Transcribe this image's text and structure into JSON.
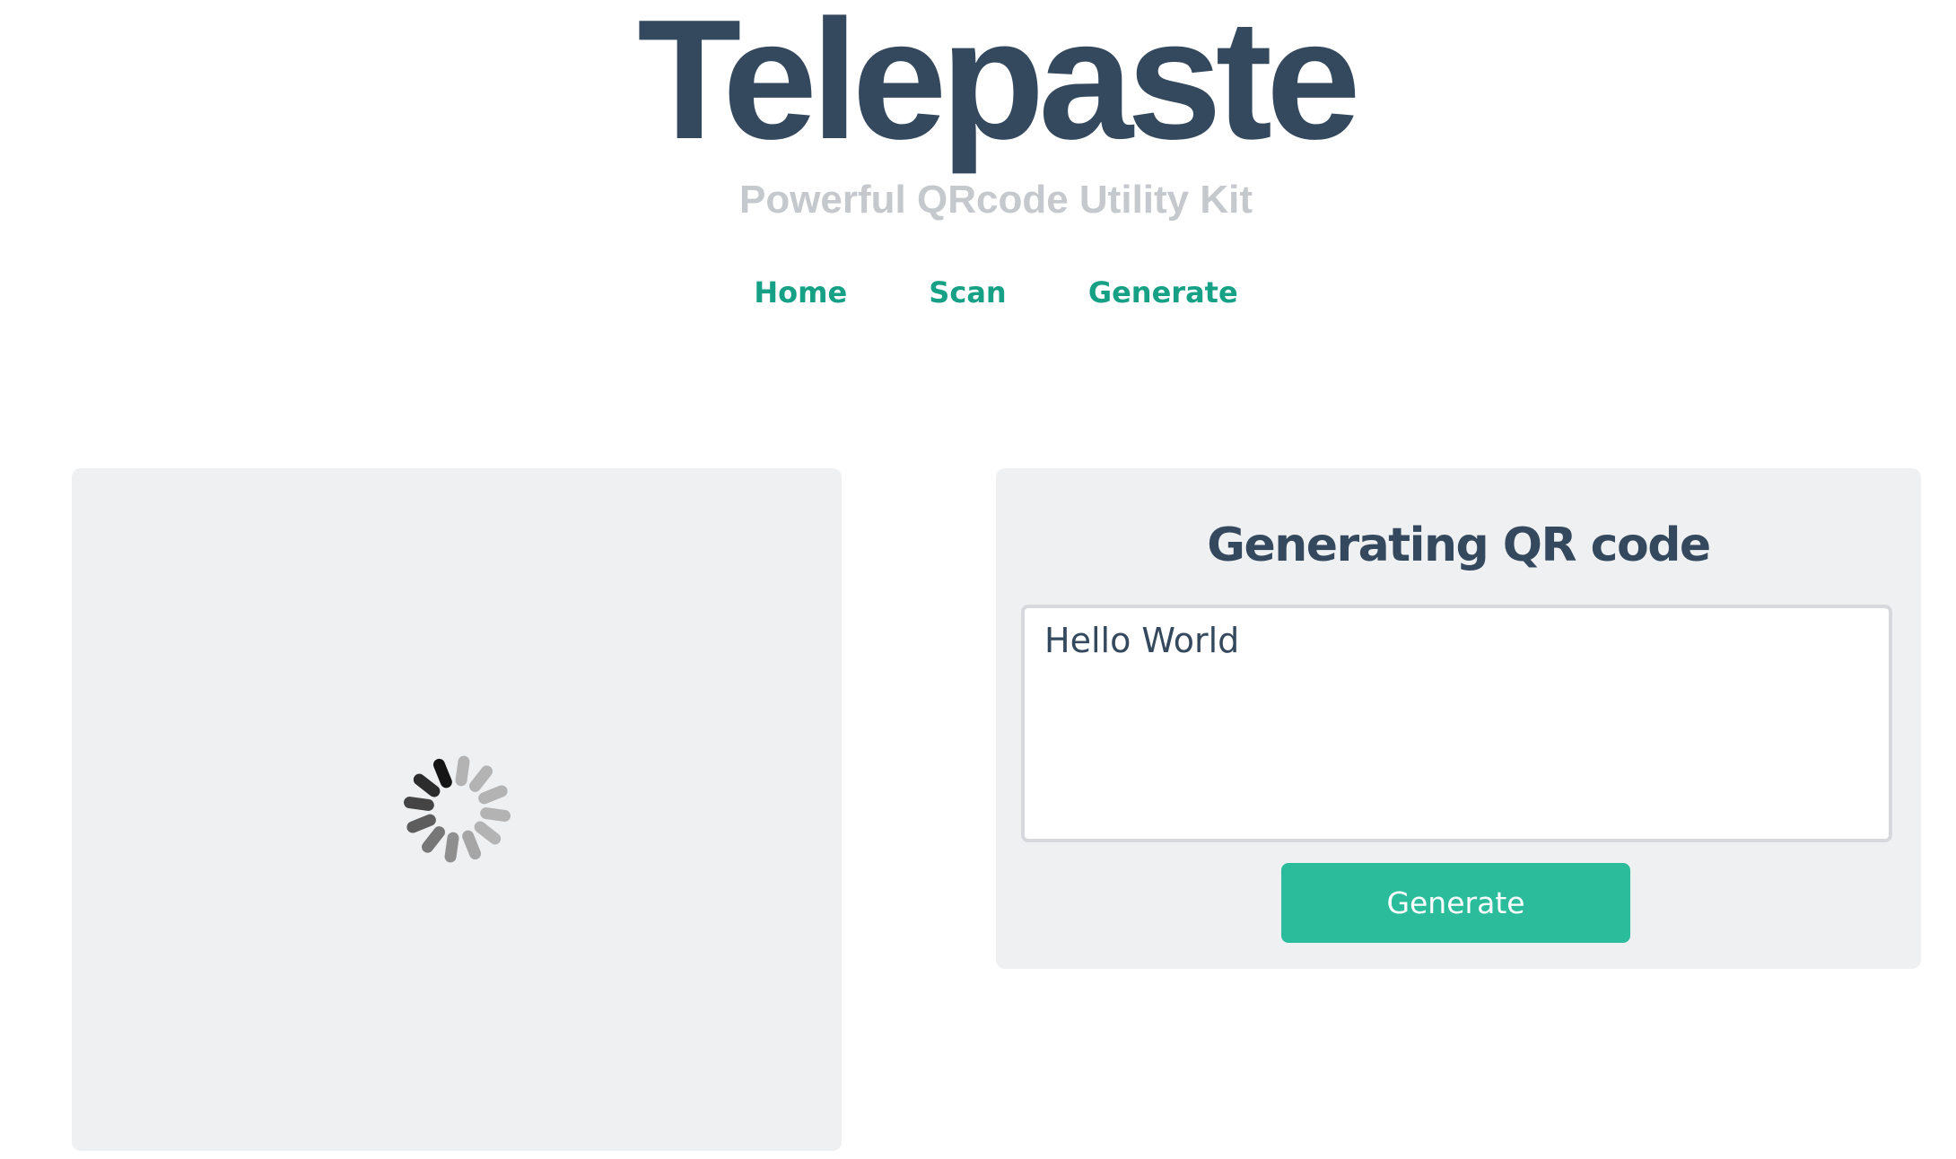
{
  "header": {
    "logo_text": "Telepaste",
    "tagline": "Powerful QRcode Utility Kit"
  },
  "nav": {
    "items": [
      {
        "label": "Home"
      },
      {
        "label": "Scan"
      },
      {
        "label": "Generate"
      }
    ]
  },
  "preview_panel": {
    "state": "loading",
    "spinner_icon": "loading-spinner-icon"
  },
  "generator_panel": {
    "title": "Generating QR code",
    "input_value": "Hello World",
    "button_label": "Generate"
  },
  "colors": {
    "brand_text": "#34495e",
    "tagline": "#c5c8cc",
    "nav_link": "#16a085",
    "accent_button": "#2bbc9b",
    "panel_bg": "#eff0f2"
  }
}
